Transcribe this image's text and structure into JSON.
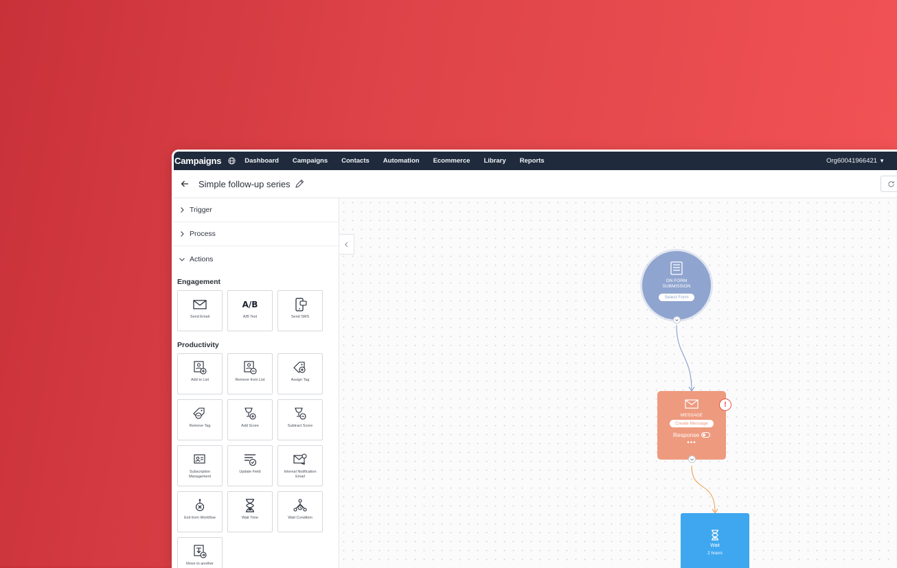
{
  "nav": {
    "brand": "Campaigns",
    "items": [
      "Dashboard",
      "Campaigns",
      "Contacts",
      "Automation",
      "Ecommerce",
      "Library",
      "Reports"
    ],
    "org": "Org60041966421"
  },
  "header": {
    "title": "Simple follow-up series"
  },
  "sidebar": {
    "trigger": "Trigger",
    "process": "Process",
    "actions": "Actions",
    "engagement": {
      "heading": "Engagement",
      "tiles": [
        {
          "label": "Send Email",
          "icon": "envelope-icon"
        },
        {
          "label": "A/B Test",
          "glyph": "A/B",
          "icon": "ab-test-icon"
        },
        {
          "label": "Send SMS",
          "icon": "sms-icon"
        }
      ]
    },
    "productivity": {
      "heading": "Productivity",
      "tiles": [
        {
          "label": "Add to List",
          "icon": "add-to-list-icon"
        },
        {
          "label": "Remove from List",
          "icon": "remove-from-list-icon"
        },
        {
          "label": "Assign Tag",
          "icon": "assign-tag-icon"
        },
        {
          "label": "Remove Tag",
          "icon": "remove-tag-icon"
        },
        {
          "label": "Add Score",
          "icon": "add-score-icon"
        },
        {
          "label": "Subtract Score",
          "icon": "subtract-score-icon"
        },
        {
          "label": "Subscription Management",
          "icon": "subscription-icon"
        },
        {
          "label": "Update Field",
          "icon": "update-field-icon"
        },
        {
          "label": "Internal Notification Email",
          "icon": "notification-email-icon"
        },
        {
          "label": "Exit from Workflow",
          "icon": "exit-workflow-icon"
        },
        {
          "label": "Wait Time",
          "icon": "hourglass-icon"
        },
        {
          "label": "Wait Condition",
          "icon": "wait-condition-icon"
        },
        {
          "label": "Move to another",
          "icon": "move-workflow-icon"
        }
      ]
    }
  },
  "canvas": {
    "trigger_node": {
      "title": "ON FORM SUBMISSION",
      "button": "Select Form"
    },
    "message_node": {
      "title": "MESSAGE",
      "button": "Create Message",
      "response": "Response",
      "more": "•••",
      "warning": "!"
    },
    "wait_node": {
      "title": "Wait",
      "duration": "2 hours"
    }
  },
  "colors": {
    "background_gradient_start": "#c9313a",
    "background_gradient_end": "#f45456",
    "nav_bg": "#1f2a3c",
    "trigger_node": "#8fa4cf",
    "message_node": "#ee9a7f",
    "wait_node": "#3fa7ef",
    "warning": "#e8534d"
  }
}
